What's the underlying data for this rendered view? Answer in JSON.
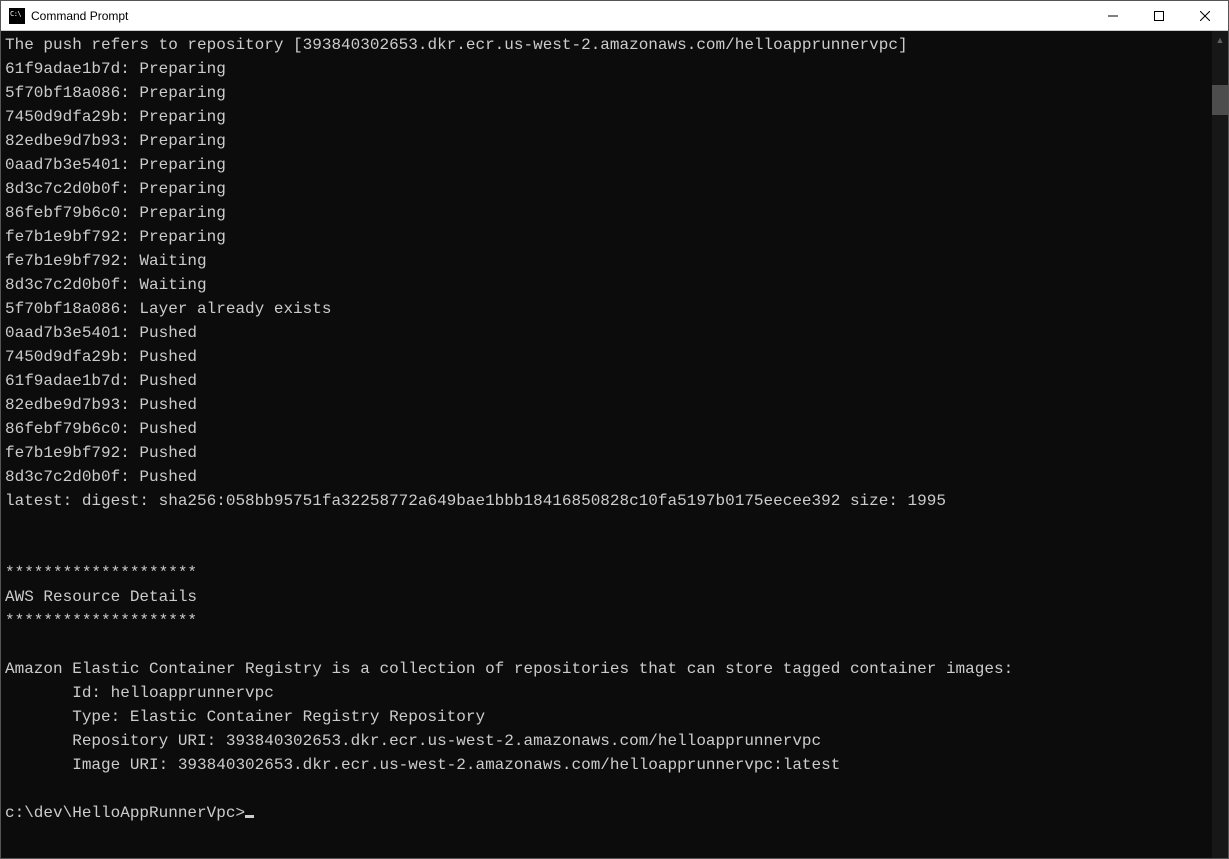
{
  "window": {
    "title": "Command Prompt"
  },
  "terminal": {
    "lines": [
      "The push refers to repository [393840302653.dkr.ecr.us-west-2.amazonaws.com/helloapprunnervpc]",
      "61f9adae1b7d: Preparing",
      "5f70bf18a086: Preparing",
      "7450d9dfa29b: Preparing",
      "82edbe9d7b93: Preparing",
      "0aad7b3e5401: Preparing",
      "8d3c7c2d0b0f: Preparing",
      "86febf79b6c0: Preparing",
      "fe7b1e9bf792: Preparing",
      "fe7b1e9bf792: Waiting",
      "8d3c7c2d0b0f: Waiting",
      "5f70bf18a086: Layer already exists",
      "0aad7b3e5401: Pushed",
      "7450d9dfa29b: Pushed",
      "61f9adae1b7d: Pushed",
      "82edbe9d7b93: Pushed",
      "86febf79b6c0: Pushed",
      "fe7b1e9bf792: Pushed",
      "8d3c7c2d0b0f: Pushed",
      "latest: digest: sha256:058bb95751fa32258772a649bae1bbb18416850828c10fa5197b0175eecee392 size: 1995",
      "",
      "",
      "********************",
      "AWS Resource Details",
      "********************",
      "",
      "Amazon Elastic Container Registry is a collection of repositories that can store tagged container images:",
      "       Id: helloapprunnervpc",
      "       Type: Elastic Container Registry Repository",
      "       Repository URI: 393840302653.dkr.ecr.us-west-2.amazonaws.com/helloapprunnervpc",
      "       Image URI: 393840302653.dkr.ecr.us-west-2.amazonaws.com/helloapprunnervpc:latest",
      ""
    ],
    "prompt": "c:\\dev\\HelloAppRunnerVpc>"
  }
}
